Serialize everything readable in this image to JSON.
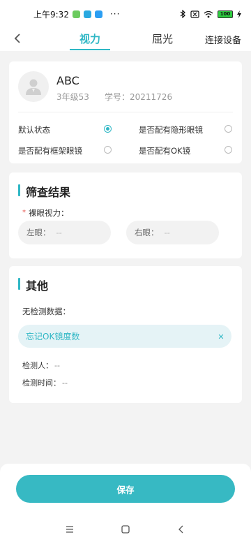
{
  "status_bar": {
    "time": "上午9:32",
    "dots": "···",
    "battery": "100",
    "app_colors": [
      "#6ccb5f",
      "#2aa9e0",
      "#2b9ef3"
    ]
  },
  "nav": {
    "tabs": [
      "视力",
      "屈光"
    ],
    "active_tab_index": 0,
    "connect_label": "连接设备"
  },
  "profile": {
    "name": "ABC",
    "grade": "3年级53",
    "student_id_label": "学号：20211726",
    "options": [
      {
        "label": "默认状态",
        "selected": true
      },
      {
        "label": "是否配有隐形眼镜",
        "selected": false
      },
      {
        "label": "是否配有框架眼镜",
        "selected": false
      },
      {
        "label": "是否配有OK镜",
        "selected": false
      }
    ]
  },
  "screening": {
    "title": "筛查结果",
    "required_mark": "*",
    "naked_vision_label": "裸眼视力：",
    "left_eye_label": "左眼：",
    "left_eye_value": "--",
    "right_eye_label": "右眼：",
    "right_eye_value": "--"
  },
  "other": {
    "title": "其他",
    "no_data_label": "无检测数据：",
    "forgot_chip_label": "忘记OK镜度数",
    "close_glyph": "✕",
    "examiner_label": "检测人：",
    "examiner_value": "--",
    "exam_time_label": "检测时间：",
    "exam_time_value": "--"
  },
  "footer": {
    "save_label": "保存"
  },
  "colors": {
    "accent": "#2fb7c5",
    "save_button": "#37b9c3",
    "required": "#e5534b"
  }
}
